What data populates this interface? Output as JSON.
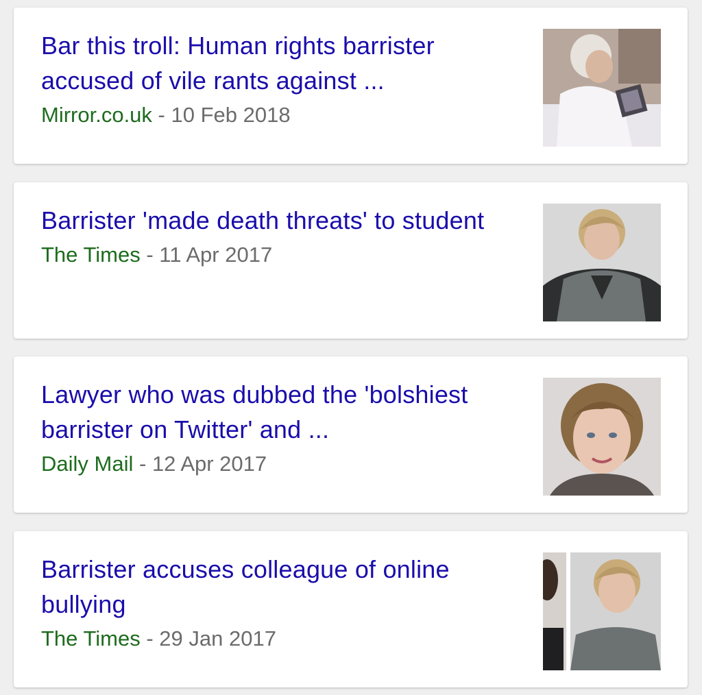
{
  "results": [
    {
      "headline": "Bar this troll: Human rights barrister accused of vile rants against ...",
      "source": "Mirror.co.uk",
      "separator": "-",
      "date": "10 Feb 2018",
      "thumbnail_icon": "photo-woman-white-top-holding-photo"
    },
    {
      "headline": "Barrister 'made death threats' to student",
      "source": "The Times",
      "separator": "-",
      "date": "11 Apr 2017",
      "thumbnail_icon": "photo-woman-grey-blazer"
    },
    {
      "headline": "Lawyer who was dubbed the 'bolshiest barrister on Twitter' and ...",
      "source": "Daily Mail",
      "separator": "-",
      "date": "12 Apr 2017",
      "thumbnail_icon": "photo-woman-portrait-smiling"
    },
    {
      "headline": "Barrister accuses colleague of online bullying",
      "source": "The Times",
      "separator": "-",
      "date": "29 Jan 2017",
      "thumbnail_icon": "photo-woman-grey-blazer-composite"
    }
  ],
  "colors": {
    "headline": "#1a0dab",
    "source": "#1e6b1e",
    "date": "#6b6b6b",
    "background": "#efefef"
  }
}
